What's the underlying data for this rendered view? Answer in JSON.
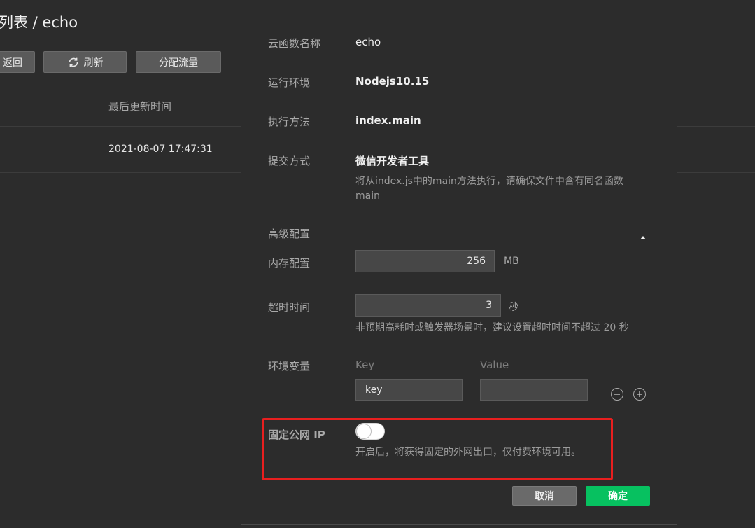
{
  "background": {
    "title": "列表 / echo",
    "buttons": {
      "back": "返回",
      "refresh": "刷新",
      "assign": "分配流量"
    },
    "table": {
      "header": "最后更新时间",
      "row_value": "2021-08-07 17:47:31"
    }
  },
  "dialog": {
    "name": {
      "label": "云函数名称",
      "value": "echo"
    },
    "runtime": {
      "label": "运行环境",
      "value": "Nodejs10.15"
    },
    "handler": {
      "label": "执行方法",
      "value": "index.main"
    },
    "submit": {
      "label": "提交方式",
      "value": "微信开发者工具",
      "hint_line1": "将从index.js中的main方法执行，请确保文件中含有同名函数",
      "hint_line2": "main"
    },
    "advanced": {
      "label": "高级配置"
    },
    "memory": {
      "label": "内存配置",
      "value": "256",
      "unit": "MB"
    },
    "timeout": {
      "label": "超时时间",
      "value": "3",
      "unit": "秒",
      "hint": "非预期高耗时或触发器场景时，建议设置超时时间不超过 20 秒"
    },
    "env": {
      "label": "环境变量",
      "key_header": "Key",
      "value_header": "Value",
      "key_value": "key",
      "value_value": ""
    },
    "fixed_ip": {
      "label": "固定公网 IP",
      "enabled": false,
      "hint": "开启后，将获得固定的外网出口，仅付费环境可用。"
    },
    "buttons": {
      "cancel": "取消",
      "ok": "确定"
    }
  },
  "icons": {
    "refresh": "refresh-icon",
    "collapse": "caret-up-icon",
    "remove": "minus-circle-icon",
    "add": "plus-circle-icon"
  },
  "colors": {
    "accent": "#07c160",
    "highlight": "#e81f1f",
    "background": "#2c2c2c"
  }
}
